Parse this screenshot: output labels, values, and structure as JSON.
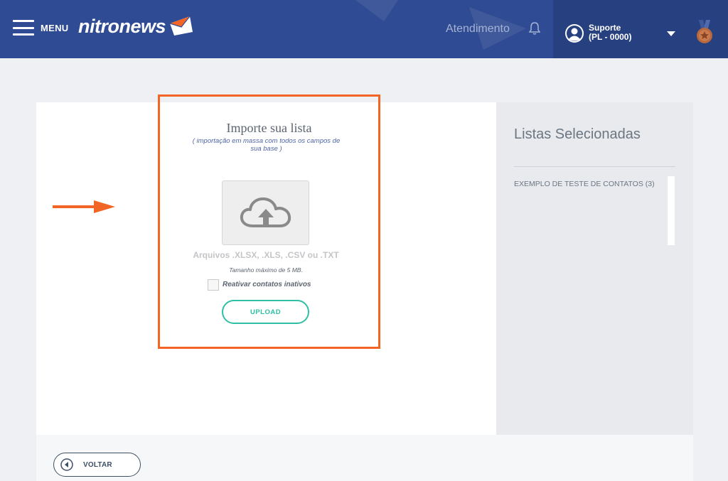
{
  "header": {
    "menu_label": "MENU",
    "logo_text": "nitronews",
    "atendimento": "Atendimento",
    "user_name": "Suporte",
    "user_code": "(PL - 0000)"
  },
  "import": {
    "title": "Importe sua lista",
    "subtitle": "( importação em massa com todos os campos de sua base )",
    "formats": "Arquivos .XLSX, .XLS, .CSV ou .TXT",
    "max_size": "Tamanho máximo de 5 MB.",
    "reactivate_label": "Reativar contatos inativos",
    "upload_label": "UPLOAD"
  },
  "selected_lists": {
    "title": "Listas Selecionadas",
    "items": [
      "EXEMPLO DE TESTE DE CONTATOS (3)"
    ]
  },
  "footer": {
    "back_label": "VOLTAR"
  },
  "colors": {
    "header_bg": "#2f4b93",
    "accent_orange": "#f26525",
    "teal": "#2ebfa5"
  },
  "icons": [
    "menu-icon",
    "envelope-logo-icon",
    "bell-icon",
    "user-avatar-icon",
    "chevron-down-icon",
    "medal-icon",
    "cloud-upload-icon",
    "arrow-right-icon",
    "back-arrow-icon"
  ]
}
